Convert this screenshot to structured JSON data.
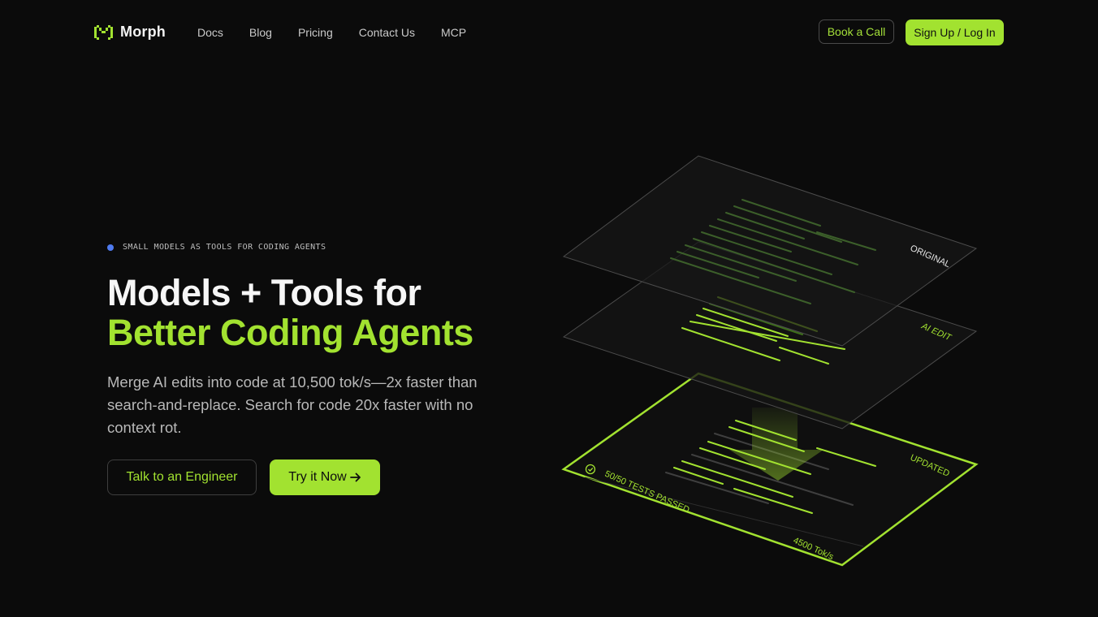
{
  "brand": {
    "name": "Morph",
    "accent": "#a2e230"
  },
  "nav": {
    "links": [
      "Docs",
      "Blog",
      "Pricing",
      "Contact Us",
      "MCP"
    ],
    "book_call": "Book a Call",
    "signup": "Sign Up / Log In"
  },
  "hero": {
    "eyebrow": "SMALL MODELS AS TOOLS FOR CODING AGENTS",
    "title_line1": "Models + Tools for",
    "title_line2": "Better Coding Agents",
    "description": "Merge AI edits into code at 10,500 tok/s—2x faster than search-and-replace. Search for code 20x faster with no context rot.",
    "cta_secondary": "Talk to an Engineer",
    "cta_primary": "Try it Now",
    "cta_primary_icon": "arrow-right-icon"
  },
  "illustration": {
    "layer_original": "ORIGINAL",
    "layer_ai_edit": "AI EDIT",
    "layer_updated": "UPDATED",
    "tests_passed": "50/50 TESTS PASSED",
    "throughput": "4500 Tok/s",
    "check_icon": "check-circle-icon",
    "arrow_icon": "arrow-down-icon"
  }
}
